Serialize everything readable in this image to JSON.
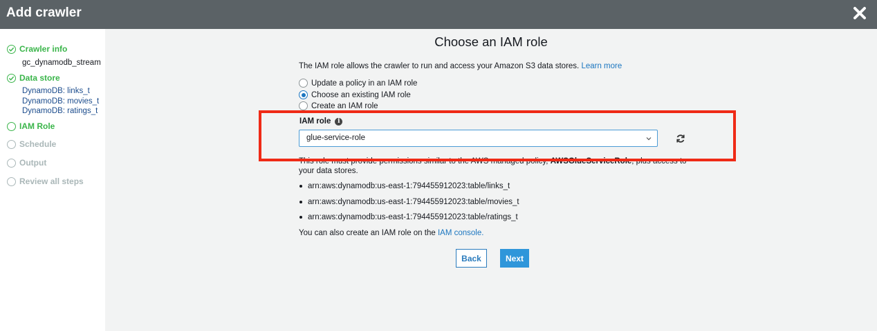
{
  "header": {
    "title": "Add crawler",
    "close_icon": "close-icon"
  },
  "sidebar": {
    "steps": [
      {
        "label": "Crawler info",
        "state": "done",
        "sub": [
          "gc_dynamodb_stream"
        ]
      },
      {
        "label": "Data store",
        "state": "done",
        "sub": [
          "DynamoDB: links_t",
          "DynamoDB: movies_t",
          "DynamoDB: ratings_t"
        ]
      },
      {
        "label": "IAM Role",
        "state": "current"
      },
      {
        "label": "Schedule",
        "state": "pending"
      },
      {
        "label": "Output",
        "state": "pending"
      },
      {
        "label": "Review all steps",
        "state": "pending"
      }
    ]
  },
  "main": {
    "heading": "Choose an IAM role",
    "description": "The IAM role allows the crawler to run and access your Amazon S3 data stores.",
    "learn_more": "Learn more",
    "radio_options": [
      {
        "label": "Update a policy in an IAM role",
        "checked": false
      },
      {
        "label": "Choose an existing IAM role",
        "checked": true
      },
      {
        "label": "Create an IAM role",
        "checked": false
      }
    ],
    "iam_role_label": "IAM role",
    "iam_role_value": "glue-service-role",
    "policy_text_1": "This role must provide permissions similar to the AWS managed policy,",
    "policy_name": "AWSGlueServiceRole",
    "policy_text_2": ", plus access to",
    "policy_text_3": "your data stores.",
    "resources": [
      "arn:aws:dynamodb:us-east-1:794455912023:table/links_t",
      "arn:aws:dynamodb:us-east-1:794455912023:table/movies_t",
      "arn:aws:dynamodb:us-east-1:794455912023:table/ratings_t"
    ],
    "console_text": "You can also create an IAM role on the",
    "console_link": "IAM console.",
    "back_label": "Back",
    "next_label": "Next"
  },
  "colors": {
    "header_bg": "#5b6266",
    "success": "#3ab54a",
    "link": "#1b76c0",
    "highlight": "#ef2a16",
    "primary": "#2f96da"
  }
}
